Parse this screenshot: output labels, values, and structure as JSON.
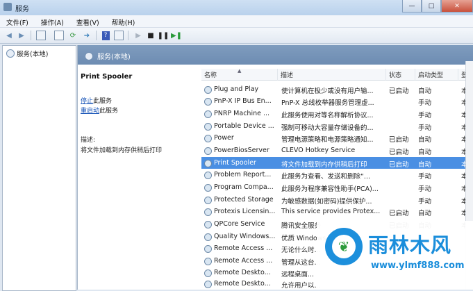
{
  "window": {
    "title": "服务",
    "buttons": [
      "—",
      "□",
      "✕"
    ]
  },
  "menu": [
    "文件(F)",
    "操作(A)",
    "查看(V)",
    "帮助(H)"
  ],
  "tree": {
    "item": "服务(本地)"
  },
  "panel_header": "服务(本地)",
  "detail": {
    "title": "Print Spooler",
    "stop_link": "停止",
    "stop_suffix": "此服务",
    "restart_link": "重启动",
    "restart_suffix": "此服务",
    "desc_label": "描述:",
    "desc_text": "将文件加载到内存供稍后打印"
  },
  "columns": [
    "名称",
    "描述",
    "状态",
    "启动类型",
    "登"
  ],
  "rows": [
    {
      "name": "Plug and Play",
      "desc": "使计算机在极少或没有用户输...",
      "state": "已启动",
      "start": "自动",
      "x": "本"
    },
    {
      "name": "PnP-X IP Bus En...",
      "desc": "PnP-X 总线枚举器服务管理虚...",
      "state": "",
      "start": "手动",
      "x": "本"
    },
    {
      "name": "PNRP Machine ...",
      "desc": "此服务使用对等名称解析协议...",
      "state": "",
      "start": "手动",
      "x": "本"
    },
    {
      "name": "Portable Device ...",
      "desc": "强制可移动大容量存储设备的...",
      "state": "",
      "start": "手动",
      "x": "本"
    },
    {
      "name": "Power",
      "desc": "管理电源策略和电源策略通知...",
      "state": "已启动",
      "start": "自动",
      "x": "本"
    },
    {
      "name": "PowerBiosServer",
      "desc": "CLEVO Hotkey Service",
      "state": "已启动",
      "start": "自动",
      "x": "本"
    },
    {
      "name": "Print Spooler",
      "desc": "将文件加载到内存供稍后打印",
      "state": "已启动",
      "start": "自动",
      "x": "本"
    },
    {
      "name": "Problem Report...",
      "desc": "此服务为查看、发送和删除“...",
      "state": "",
      "start": "手动",
      "x": "本"
    },
    {
      "name": "Program Compa...",
      "desc": "此服务为程序兼容性助手(PCA)...",
      "state": "",
      "start": "手动",
      "x": "本"
    },
    {
      "name": "Protected Storage",
      "desc": "为敏感数据(如密码)提供保护...",
      "state": "",
      "start": "手动",
      "x": "本"
    },
    {
      "name": "Protexis Licensin...",
      "desc": "This service provides Protex...",
      "state": "已启动",
      "start": "自动",
      "x": "本"
    },
    {
      "name": "QPCore Service",
      "desc": "腾讯安全服务",
      "state": "已启动",
      "start": "自动",
      "x": "本"
    },
    {
      "name": "Quality Windows...",
      "desc": "优质 Windows...",
      "state": "",
      "start": "",
      "x": ""
    },
    {
      "name": "Remote Access ...",
      "desc": "无论什么时...",
      "state": "",
      "start": "",
      "x": ""
    },
    {
      "name": "Remote Access ...",
      "desc": "管理从这台...",
      "state": "",
      "start": "",
      "x": ""
    },
    {
      "name": "Remote Deskto...",
      "desc": "远程桌面...",
      "state": "",
      "start": "",
      "x": ""
    },
    {
      "name": "Remote Deskto...",
      "desc": "允许用户以...",
      "state": "",
      "start": "",
      "x": ""
    }
  ],
  "watermark": {
    "text": "雨林木风",
    "url": "www.ylmf888.com"
  },
  "colors": {
    "selected_row": "#4a8fe3",
    "header": "#7f9cbe",
    "link": "#1a56b8",
    "watermark": "#1b8edb"
  },
  "icons": [
    "back-icon",
    "forward-icon",
    "console-icon",
    "properties-icon",
    "refresh-icon",
    "export-icon",
    "help-icon",
    "view-icon",
    "play-icon",
    "stop-icon",
    "pause-icon",
    "restart-icon",
    "gear-icon"
  ]
}
